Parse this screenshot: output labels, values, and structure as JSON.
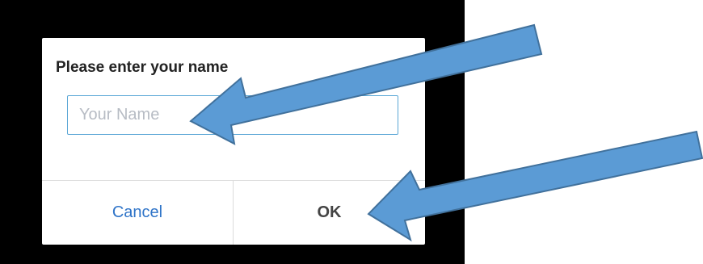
{
  "dialog": {
    "title": "Please enter your name",
    "input_placeholder": "Your Name",
    "input_value": "",
    "cancel_label": "Cancel",
    "ok_label": "OK"
  },
  "colors": {
    "screen_background": "#000000",
    "dialog_background": "#ffffff",
    "input_border": "#5ba7d6",
    "cancel_text": "#2f74c8",
    "ok_text": "#444444",
    "annotation_arrow_fill": "#5b9bd5",
    "annotation_arrow_stroke": "#41719c"
  },
  "annotations": {
    "arrow_count": 2,
    "arrow_icon": "pointer-arrow-icon"
  }
}
